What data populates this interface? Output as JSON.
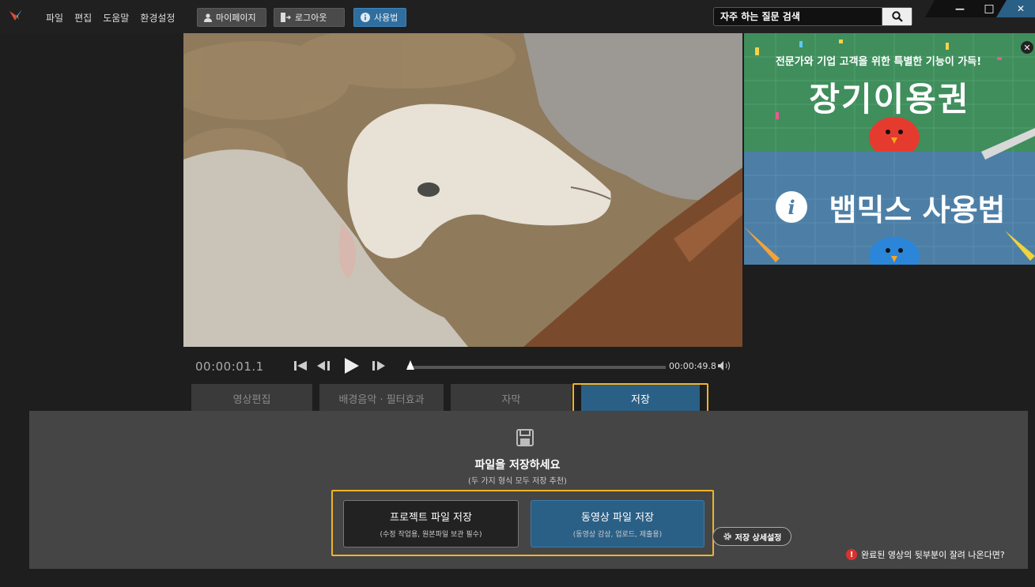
{
  "menu": {
    "file": "파일",
    "edit": "편집",
    "help": "도움말",
    "settings": "환경설정"
  },
  "topbar": {
    "mypage": "마이페이지",
    "logout": "로그아웃",
    "howto": "사용법"
  },
  "search": {
    "placeholder": "자주 하는 질문 검색"
  },
  "window": {
    "minimize": "—",
    "maximize": "□",
    "close": "✕"
  },
  "ad": {
    "tagline": "전문가와 기업 고객을 위한 특별한 기능이 가득!",
    "title": "장기이용권",
    "title2": "뱁믹스 사용법",
    "close_glyph": "✕"
  },
  "player": {
    "current_time": "00:00:01.1",
    "end_time": "00:00:49.8",
    "progress": 0.01
  },
  "tabs": [
    {
      "label": "영상편집"
    },
    {
      "label": "배경음악 · 필터효과"
    },
    {
      "label": "자막"
    },
    {
      "label": "저장"
    }
  ],
  "save_panel": {
    "title": "파일을 저장하세요",
    "subtitle": "(두 가지 형식 모두 저장 추천)",
    "project_btn": {
      "title": "프로젝트 파일 저장",
      "sub": "(수정 작업용, 원본파일 보관 필수)"
    },
    "video_btn": {
      "title": "동영상 파일 저장",
      "sub": "(동영상 감상, 업로드, 제출용)"
    },
    "detail": "저장 상세설정",
    "help": "완료된 영상의 뒷부분이 잘려 나온다면?",
    "help_glyph": "!"
  },
  "colors": {
    "accent": "#2a5f86",
    "highlight": "#f0b428",
    "panel": "#454545"
  }
}
